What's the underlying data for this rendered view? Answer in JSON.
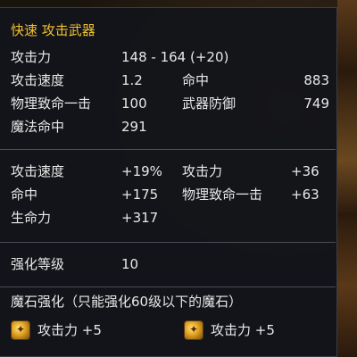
{
  "tooltip": {
    "title": "快速 攻击武器",
    "base_stats": [
      {
        "label": "攻击力",
        "value": "148 - 164 (+20)"
      },
      {
        "label": "攻击速度",
        "value": "1.2",
        "label2": "命中",
        "value2": "883"
      },
      {
        "label": "物理致命一击",
        "value": "100",
        "label2": "武器防御",
        "value2": "749"
      },
      {
        "label": "魔法命中",
        "value": "291"
      }
    ],
    "bonus_stats": [
      {
        "label": "攻击速度",
        "value": "+19%",
        "label2": "攻击力",
        "value2": "+36"
      },
      {
        "label": "命中",
        "value": "+175",
        "label2": "物理致命一击",
        "value2": "+63"
      },
      {
        "label": "生命力",
        "value": "+317"
      }
    ],
    "enhance": {
      "label": "强化等级",
      "value": "10"
    },
    "manastone": {
      "header": "魔石强化（只能强化60级以下的魔石）",
      "slots": [
        {
          "icon": "manastone-icon",
          "text": "攻击力 +5"
        },
        {
          "icon": "manastone-icon",
          "text": "攻击力 +5"
        }
      ]
    }
  },
  "colors": {
    "label": "#e8e8e8",
    "title": "#f0c030",
    "panel": "#12141a"
  }
}
